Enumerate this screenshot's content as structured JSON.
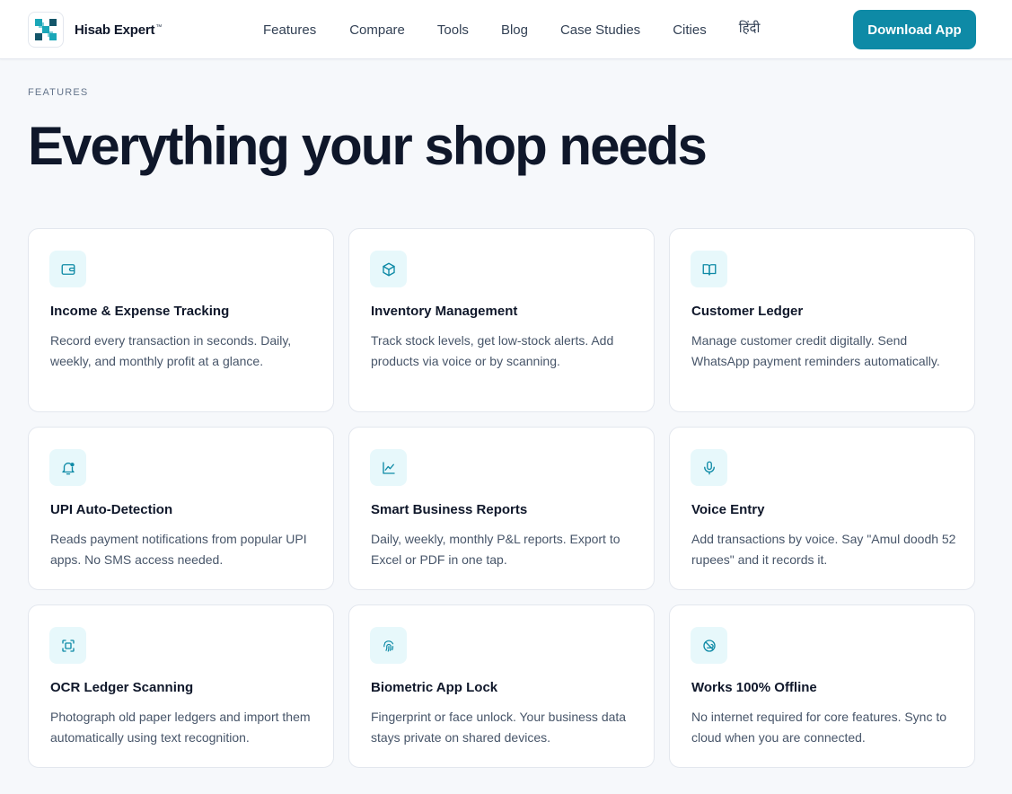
{
  "brand": {
    "name": "Hisab Expert",
    "tm": "™",
    "logo_colors": [
      "#1aa7b8",
      "#14566a"
    ]
  },
  "nav": {
    "items": [
      "Features",
      "Compare",
      "Tools",
      "Blog",
      "Case Studies",
      "Cities",
      "हिंदी"
    ],
    "cta": "Download App"
  },
  "section": {
    "eyebrow": "FEATURES",
    "headline": "Everything your shop needs"
  },
  "colors": {
    "accent": "#0e8aa6",
    "icon_bg": "#e7f8fb",
    "icon_stroke": "#0e8aa6"
  },
  "features": [
    {
      "icon": "wallet-icon",
      "title": "Income & Expense Tracking",
      "desc": "Record every transaction in seconds. Daily, weekly, and monthly profit at a glance."
    },
    {
      "icon": "box-icon",
      "title": "Inventory Management",
      "desc": "Track stock levels, get low-stock alerts. Add products via voice or by scanning."
    },
    {
      "icon": "book-icon",
      "title": "Customer Ledger",
      "desc": "Manage customer credit digitally. Send WhatsApp payment reminders automatically."
    },
    {
      "icon": "bell-icon",
      "title": "UPI Auto-Detection",
      "desc": "Reads payment notifications from popular UPI apps. No SMS access needed."
    },
    {
      "icon": "line-chart-icon",
      "title": "Smart Business Reports",
      "desc": "Daily, weekly, monthly P&L reports. Export to Excel or PDF in one tap."
    },
    {
      "icon": "microphone-icon",
      "title": "Voice Entry",
      "desc": "Add transactions by voice. Say \"Amul doodh 52 rupees\" and it records it."
    },
    {
      "icon": "scan-icon",
      "title": "OCR Ledger Scanning",
      "desc": "Photograph old paper ledgers and import them automatically using text recognition."
    },
    {
      "icon": "fingerprint-icon",
      "title": "Biometric App Lock",
      "desc": "Fingerprint or face unlock. Your business data stays private on shared devices."
    },
    {
      "icon": "cloud-off-icon",
      "title": "Works 100% Offline",
      "desc": "No internet required for core features. Sync to cloud when you are connected."
    }
  ]
}
